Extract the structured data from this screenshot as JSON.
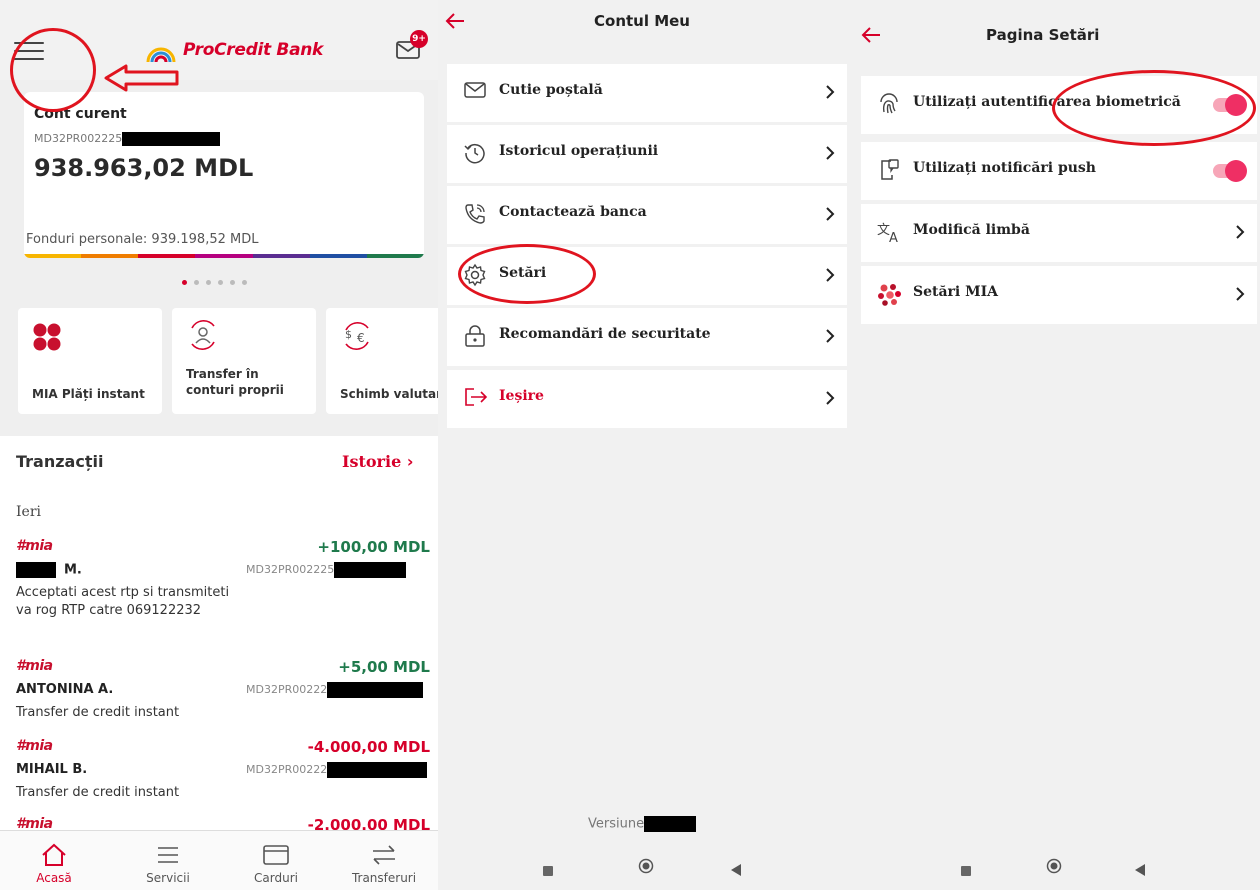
{
  "home": {
    "logo_text": "ProCredit Bank",
    "mail_badge": "9+",
    "account": {
      "title": "Cont curent",
      "iban": "MD32PR002225",
      "balance": "938.963,02 MDL",
      "funds": "Fonduri personale: 939.198,52 MDL"
    },
    "quick_actions": [
      {
        "label": "MIA Plăți instant"
      },
      {
        "label": "Transfer în conturi proprii"
      },
      {
        "label": "Schimb valutar"
      }
    ],
    "transactions": {
      "title": "Tranzacții",
      "history_link": "Istorie",
      "day_label": "Ieri",
      "mia_brand": "#mia",
      "items": [
        {
          "amount": "+100,00 MDL",
          "name": "M.",
          "iban": "MD32PR002225",
          "desc": "Acceptati acest rtp si transmiteti va rog RTP catre 069122232",
          "sign": "pos"
        },
        {
          "amount": "+5,00 MDL",
          "name": "ANTONINA A.",
          "iban": "MD32PR00222",
          "desc": "Transfer de credit instant",
          "sign": "pos"
        },
        {
          "amount": "-4.000,00 MDL",
          "name": "MIHAIL B.",
          "iban": "MD32PR00222",
          "desc": "Transfer de credit instant",
          "sign": "neg"
        },
        {
          "amount": "-2.000.00 MDL",
          "name": "",
          "iban": "",
          "desc": "",
          "sign": "neg"
        }
      ]
    },
    "bottom_nav": [
      {
        "label": "Acasă",
        "active": true
      },
      {
        "label": "Servicii"
      },
      {
        "label": "Carduri"
      },
      {
        "label": "Transferuri"
      }
    ]
  },
  "account_menu": {
    "title": "Contul Meu",
    "items": [
      {
        "label": "Cutie poștală",
        "icon": "mail-icon"
      },
      {
        "label": "Istoricul operațiunii",
        "icon": "history-icon"
      },
      {
        "label": "Contactează banca",
        "icon": "phone-icon"
      },
      {
        "label": "Setări",
        "icon": "gear-icon"
      },
      {
        "label": "Recomandări de securitate",
        "icon": "lock-icon"
      },
      {
        "label": "Ieșire",
        "icon": "logout-icon"
      }
    ],
    "version_label": "Versiune"
  },
  "settings": {
    "title": "Pagina Setări",
    "items": [
      {
        "label": "Utilizați autentificarea biometrică",
        "icon": "fingerprint-icon",
        "toggle": true
      },
      {
        "label": "Utilizați notificări push",
        "icon": "phone-notification-icon",
        "toggle": true
      },
      {
        "label": "Modifică limbă",
        "icon": "translate-icon"
      },
      {
        "label": "Setări MIA",
        "icon": "mia-icon"
      }
    ]
  },
  "colors": {
    "brand_red": "#d6002a",
    "positive_green": "#1f7a4c",
    "toggle_pink": "#ef2f64",
    "annotation_red": "#e0141f"
  }
}
